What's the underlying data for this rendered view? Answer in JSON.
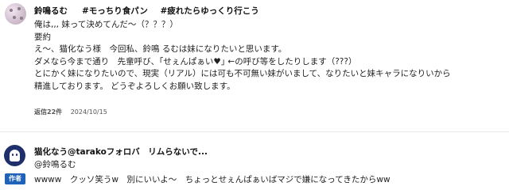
{
  "comments": [
    {
      "author": "鈴鳴るむ",
      "tags": [
        "#モっちり食パン",
        "#疲れたらゆっくり行こう"
      ],
      "lines": [
        "俺は,,, 妹って決めてんだ〜（？？？）",
        "要約",
        "え〜、猫化なう様　今回私、鈴鳴 るむは妹になりたいと思います。",
        "ダメなら今まで通り　先輩呼び、｢せぇんぱぁい♥｣ ←の呼び等をしたりします（???）",
        "とにかく妹になりたいので、現実（リアル）には可も不可無い妹がいまして、なりたいと妹キャラになりいから",
        "精進しております。 どうぞよろしくお願い致します。"
      ],
      "reply_count": "返信22件",
      "date": "2024/10/15"
    },
    {
      "author": "猫化なう@tarakoフォロバ　リムらないで...",
      "badge": "作者",
      "mention": "@鈴鳴るむ",
      "text": "wwww　クッソ笑うw　別にいいよ〜　ちょっとせぇんぱぁいばマジで嫌になってきたからww"
    }
  ]
}
